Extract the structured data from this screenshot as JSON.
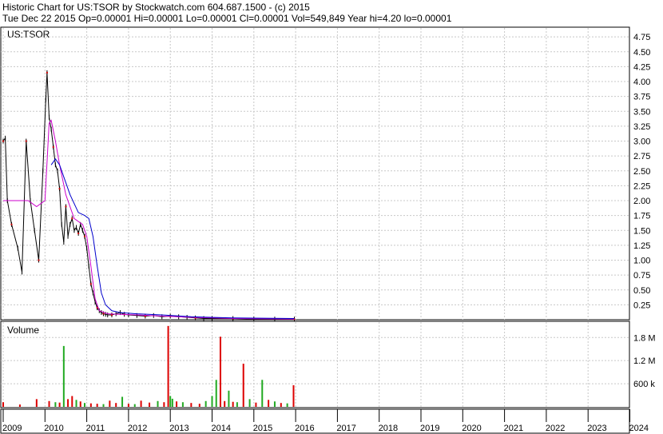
{
  "header": {
    "line1": "Historic Chart for US:TSOR by Stockwatch.com 604.687.1500 - (c) 2015",
    "line2": "Tue Dec 22 2015   Op=0.00001   Hi=0.00001   Lo=0.00001   Cl=0.00001   Vol=549,849   Year hi=4.20   lo=0.00001"
  },
  "colors": {
    "price": "#000000",
    "down_marker": "#cc0000",
    "ma_short": "#cc00cc",
    "ma_long": "#0000cc",
    "volume_up": "#22aa22",
    "volume_down": "#dd0000",
    "grid": "#c8c8c8"
  },
  "chart_data": [
    {
      "type": "line",
      "title": "US:TSOR",
      "ylim": [
        0,
        4.9
      ],
      "y_ticks": [
        "0.25",
        "0.50",
        "0.75",
        "1.00",
        "1.25",
        "1.50",
        "1.75",
        "2.00",
        "2.25",
        "2.50",
        "2.75",
        "3.00",
        "3.25",
        "3.50",
        "3.75",
        "4.00",
        "4.25",
        "4.50",
        "4.75"
      ],
      "x_ticks": [
        "2009",
        "2010",
        "2011",
        "2012",
        "2013",
        "2014",
        "2015",
        "2016",
        "2017",
        "2018",
        "2019",
        "2020",
        "2021",
        "2022",
        "2023",
        "2024"
      ],
      "grid": true,
      "series": [
        {
          "role": "price",
          "x": [
            2009.0,
            2009.05,
            2009.1,
            2009.2,
            2009.35,
            2009.45,
            2009.55,
            2009.65,
            2009.75,
            2009.85,
            2009.95,
            2010.02,
            2010.05,
            2010.1,
            2010.15,
            2010.2,
            2010.25,
            2010.3,
            2010.35,
            2010.4,
            2010.45,
            2010.5,
            2010.55,
            2010.6,
            2010.65,
            2010.7,
            2010.75,
            2010.8,
            2010.85,
            2010.9,
            2010.95,
            2011.0,
            2011.05,
            2011.1,
            2011.15,
            2011.2,
            2011.25,
            2011.3,
            2011.35,
            2011.4,
            2011.45,
            2011.5,
            2011.6,
            2011.7,
            2011.8,
            2011.9,
            2012.0,
            2012.2,
            2012.4,
            2012.6,
            2012.8,
            2013.0,
            2013.2,
            2013.4,
            2013.6,
            2013.8,
            2014.0,
            2014.5,
            2015.0,
            2015.5,
            2015.97
          ],
          "y": [
            3.0,
            3.05,
            2.0,
            1.6,
            1.2,
            0.8,
            3.0,
            2.0,
            1.5,
            1.0,
            2.5,
            3.7,
            4.15,
            3.4,
            3.2,
            2.9,
            2.6,
            2.5,
            2.2,
            1.6,
            1.3,
            1.9,
            1.4,
            1.6,
            1.7,
            1.5,
            1.55,
            1.45,
            1.6,
            1.5,
            1.4,
            1.2,
            0.9,
            0.6,
            0.45,
            0.3,
            0.2,
            0.15,
            0.12,
            0.1,
            0.09,
            0.08,
            0.08,
            0.1,
            0.12,
            0.09,
            0.08,
            0.07,
            0.06,
            0.07,
            0.05,
            0.06,
            0.05,
            0.04,
            0.03,
            0.02,
            0.02,
            0.02,
            0.01,
            0.01,
            0.01
          ]
        },
        {
          "role": "ma_short",
          "x": [
            2009.0,
            2009.2,
            2009.4,
            2009.6,
            2009.8,
            2010.0,
            2010.1,
            2010.15,
            2010.25,
            2010.35,
            2010.5,
            2010.7,
            2010.9,
            2011.0,
            2011.1,
            2011.2,
            2011.3,
            2011.5,
            2011.8,
            2012.2,
            2012.8,
            2013.5,
            2014.5,
            2015.97
          ],
          "y": [
            2.0,
            2.0,
            2.0,
            2.0,
            1.9,
            2.0,
            3.3,
            3.35,
            3.0,
            2.6,
            2.1,
            1.7,
            1.6,
            1.4,
            0.9,
            0.35,
            0.15,
            0.1,
            0.09,
            0.08,
            0.06,
            0.04,
            0.02,
            0.01
          ]
        },
        {
          "role": "ma_long",
          "x": [
            2010.15,
            2010.25,
            2010.35,
            2010.45,
            2010.6,
            2010.8,
            2010.95,
            2011.05,
            2011.15,
            2011.25,
            2011.35,
            2011.45,
            2011.6,
            2011.8,
            2012.2,
            2012.8,
            2013.5,
            2014.5,
            2015.97
          ],
          "y": [
            2.6,
            2.7,
            2.6,
            2.4,
            2.1,
            1.8,
            1.75,
            1.7,
            1.4,
            0.9,
            0.45,
            0.25,
            0.15,
            0.12,
            0.1,
            0.08,
            0.05,
            0.03,
            0.02
          ]
        }
      ]
    },
    {
      "type": "bar",
      "title": "Volume",
      "y_ticks": [
        "600 k",
        "1.8 M",
        "1.2 M"
      ],
      "y_tick_values": [
        600000,
        1800000,
        1200000
      ],
      "ylim": [
        0,
        2200000
      ],
      "x": [
        2009.0,
        2009.4,
        2009.8,
        2010.1,
        2010.25,
        2010.35,
        2010.45,
        2010.55,
        2010.65,
        2010.75,
        2010.85,
        2010.95,
        2011.1,
        2011.25,
        2011.4,
        2011.55,
        2011.7,
        2011.85,
        2012.0,
        2012.15,
        2012.3,
        2012.5,
        2012.7,
        2012.85,
        2012.95,
        2013.0,
        2013.05,
        2013.15,
        2013.3,
        2013.5,
        2013.7,
        2013.85,
        2014.0,
        2014.1,
        2014.2,
        2014.3,
        2014.4,
        2014.5,
        2014.6,
        2014.75,
        2014.9,
        2015.05,
        2015.2,
        2015.35,
        2015.5,
        2015.65,
        2015.8,
        2015.95
      ],
      "values": [
        120000,
        60000,
        200000,
        150000,
        120000,
        110000,
        1580000,
        200000,
        280000,
        180000,
        140000,
        100000,
        90000,
        80000,
        70000,
        160000,
        100000,
        260000,
        80000,
        70000,
        160000,
        110000,
        150000,
        120000,
        2100000,
        280000,
        210000,
        140000,
        120000,
        100000,
        80000,
        150000,
        280000,
        700000,
        1820000,
        150000,
        420000,
        130000,
        120000,
        1120000,
        200000,
        110000,
        700000,
        180000,
        140000,
        100000,
        90000,
        560000
      ],
      "colors": [
        "down",
        "down",
        "down",
        "down",
        "up",
        "down",
        "up",
        "down",
        "down",
        "up",
        "down",
        "up",
        "down",
        "down",
        "up",
        "down",
        "down",
        "up",
        "down",
        "up",
        "down",
        "down",
        "up",
        "down",
        "down",
        "up",
        "up",
        "down",
        "up",
        "down",
        "down",
        "up",
        "up",
        "up",
        "down",
        "down",
        "up",
        "down",
        "up",
        "down",
        "up",
        "down",
        "up",
        "down",
        "up",
        "down",
        "up",
        "down"
      ]
    }
  ]
}
